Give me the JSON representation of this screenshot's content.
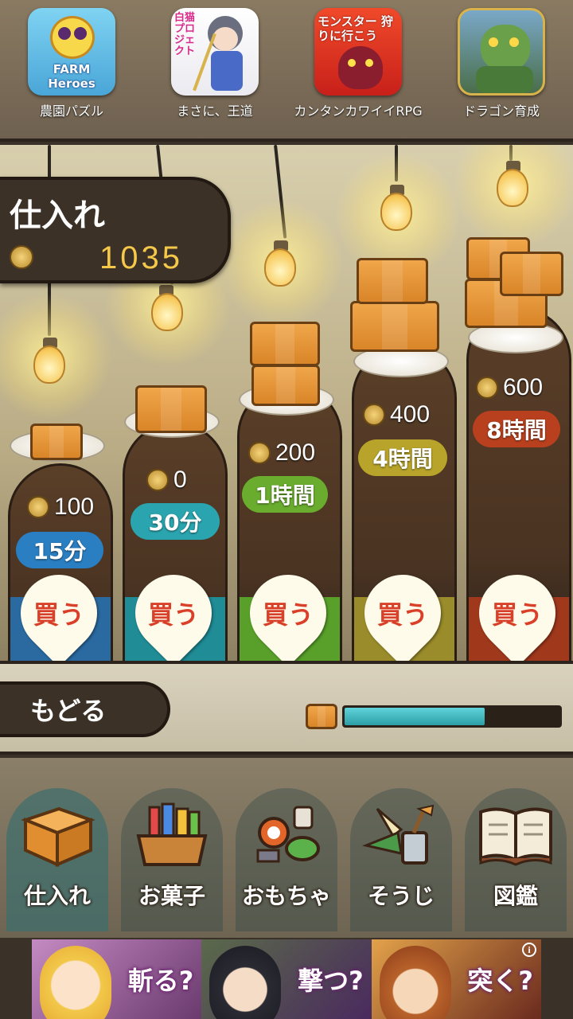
{
  "top_apps": [
    {
      "label": "農園パズル",
      "icon": "farm-heroes-icon",
      "icon_text": "FARM Heroes",
      "color": "#6cc2e8"
    },
    {
      "label": "まさに、王道",
      "icon": "white-cat-project-icon",
      "icon_text": "白猫 プロジェクト",
      "color": "#ffffff"
    },
    {
      "label": "カンタンカワイイRPG",
      "icon": "monster-hunt-icon",
      "icon_text": "モンスター 狩りに行こう",
      "color": "#e0302a"
    },
    {
      "label": "ドラゴン育成",
      "icon": "dragon-icon",
      "icon_text": "",
      "color": "#5e8a4a"
    }
  ],
  "stock_panel": {
    "title": "仕入れ",
    "coins": "1035"
  },
  "shop_items": [
    {
      "price": "100",
      "time": "15分",
      "buy": "買う",
      "time_color": "#2a7fc2",
      "stripe": "#2a6aa0"
    },
    {
      "price": "0",
      "time": "30分",
      "buy": "買う",
      "time_color": "#2aa4ae",
      "stripe": "#1f8c96"
    },
    {
      "price": "200",
      "time": "1時間",
      "buy": "買う",
      "time_color": "#6aac2e",
      "stripe": "#58a02a"
    },
    {
      "price": "400",
      "time": "4時間",
      "buy": "買う",
      "time_color": "#b8a42a",
      "stripe": "#9a8c2a"
    },
    {
      "price": "600",
      "time": "8時間",
      "buy": "買う",
      "time_color": "#b8401e",
      "stripe": "#a0381c"
    }
  ],
  "middle_bar": {
    "back_label": "もどる",
    "progress": 0.65
  },
  "bottom_nav": [
    {
      "label": "仕入れ",
      "icon": "cardboard-box-icon",
      "active": true
    },
    {
      "label": "お菓子",
      "icon": "snack-basket-icon",
      "active": false
    },
    {
      "label": "おもちゃ",
      "icon": "toys-icon",
      "active": false
    },
    {
      "label": "そうじ",
      "icon": "cleaning-tools-icon",
      "active": false
    },
    {
      "label": "図鑑",
      "icon": "open-book-icon",
      "active": false
    }
  ],
  "banner": {
    "panels": [
      {
        "text": "斬る?",
        "bg": "#8a5a8c"
      },
      {
        "text": "撃つ?",
        "bg": "#5a3a5e"
      },
      {
        "text": "突く?",
        "bg": "#a06a2a"
      }
    ],
    "info": "i"
  }
}
